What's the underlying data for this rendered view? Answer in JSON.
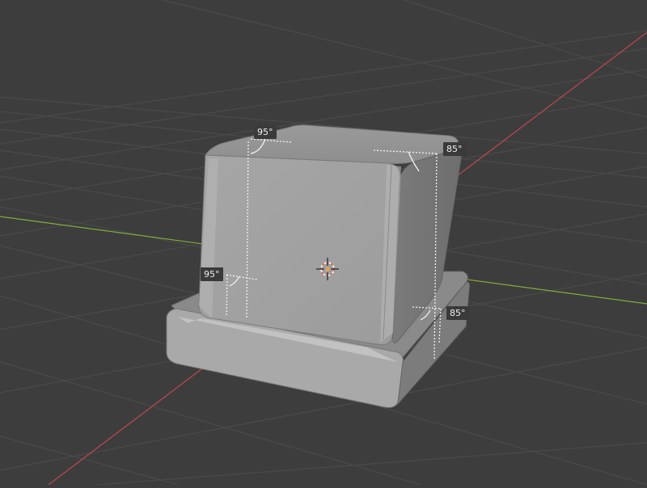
{
  "viewport": {
    "background": "#3d3d3d",
    "grid_color": "#4a4a4a",
    "x_axis_color": "#c0484f",
    "y_axis_color": "#7fae3a",
    "object_color": "#a3a3a3"
  },
  "annotations": {
    "top_left": "95°",
    "top_right": "85°",
    "mid_left": "95°",
    "bottom_right": "85°"
  },
  "icons": {
    "origin": "3d-cursor-icon"
  }
}
